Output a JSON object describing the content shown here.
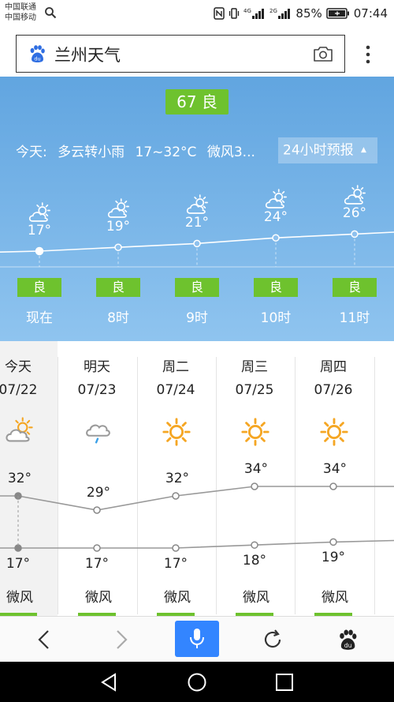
{
  "status_bar": {
    "carrier_1": "中国联通",
    "carrier_2": "中国移动",
    "battery": "85%",
    "time": "07:44"
  },
  "search": {
    "query": "兰州天气"
  },
  "aqi": {
    "value": "67 良"
  },
  "today_summary": {
    "label": "今天:",
    "condition": "多云转小雨",
    "temp_range": "17~32°C",
    "wind": "微风3..."
  },
  "forecast_toggle": "24小时预报",
  "hourly": [
    {
      "temp": 17,
      "temp_label": "17°",
      "aqi": "良",
      "time": "现在",
      "icon": "partly-cloudy-icon"
    },
    {
      "temp": 19,
      "temp_label": "19°",
      "aqi": "良",
      "time": "8时",
      "icon": "partly-cloudy-icon"
    },
    {
      "temp": 21,
      "temp_label": "21°",
      "aqi": "良",
      "time": "9时",
      "icon": "partly-cloudy-icon"
    },
    {
      "temp": 24,
      "temp_label": "24°",
      "aqi": "良",
      "time": "10时",
      "icon": "partly-cloudy-icon"
    },
    {
      "temp": 26,
      "temp_label": "26°",
      "aqi": "良",
      "time": "11时",
      "icon": "partly-cloudy-icon"
    }
  ],
  "daily": [
    {
      "day": "今天",
      "date": "07/22",
      "icon": "partly-cloudy-icon",
      "high": 32,
      "high_label": "32°",
      "low": 17,
      "low_label": "17°",
      "wind": "微风"
    },
    {
      "day": "明天",
      "date": "07/23",
      "icon": "rain-icon",
      "high": 29,
      "high_label": "29°",
      "low": 17,
      "low_label": "17°",
      "wind": "微风"
    },
    {
      "day": "周二",
      "date": "07/24",
      "icon": "sun-icon",
      "high": 32,
      "high_label": "32°",
      "low": 17,
      "low_label": "17°",
      "wind": "微风"
    },
    {
      "day": "周三",
      "date": "07/25",
      "icon": "sun-icon",
      "high": 34,
      "high_label": "34°",
      "low": 18,
      "low_label": "18°",
      "wind": "微风"
    },
    {
      "day": "周四",
      "date": "07/26",
      "icon": "sun-icon",
      "high": 34,
      "high_label": "34°",
      "low": 19,
      "low_label": "19°",
      "wind": "微风"
    }
  ],
  "colors": {
    "aqi_good": "#6ec22e",
    "sky_top": "#61a5e0",
    "accent": "#3385ff"
  }
}
